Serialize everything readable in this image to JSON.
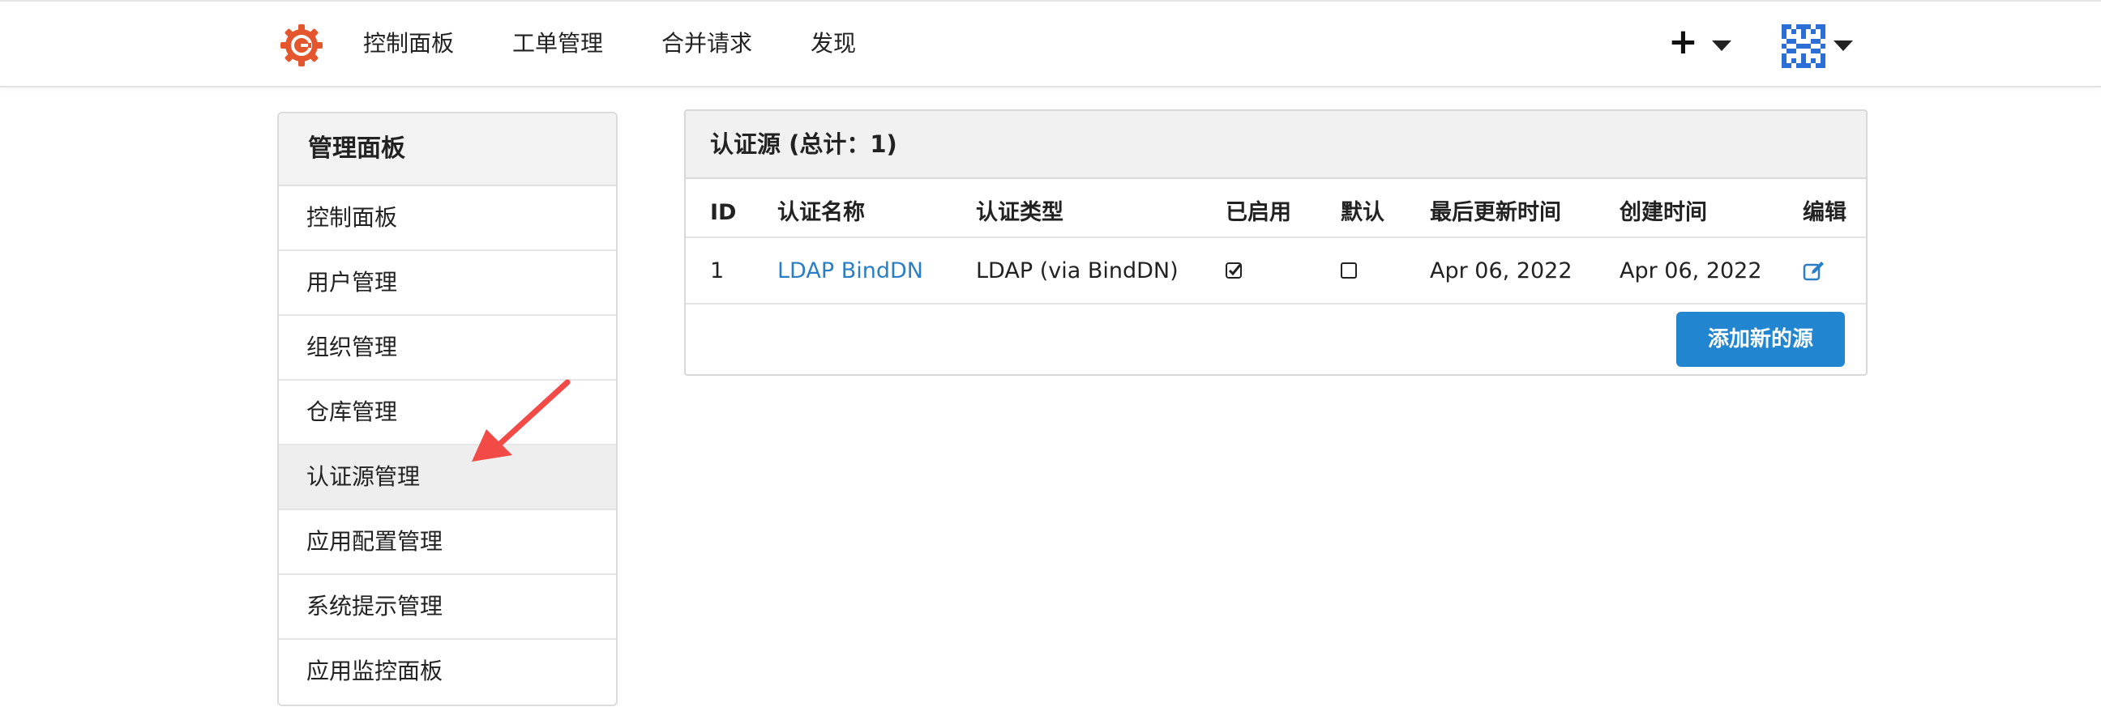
{
  "nav": {
    "items": [
      {
        "label": "控制面板"
      },
      {
        "label": "工单管理"
      },
      {
        "label": "合并请求"
      },
      {
        "label": "发现"
      }
    ],
    "plus_label": "+"
  },
  "sidebar": {
    "title": "管理面板",
    "items": [
      {
        "label": "控制面板"
      },
      {
        "label": "用户管理"
      },
      {
        "label": "组织管理"
      },
      {
        "label": "仓库管理"
      },
      {
        "label": "认证源管理"
      },
      {
        "label": "应用配置管理"
      },
      {
        "label": "系统提示管理"
      },
      {
        "label": "应用监控面板"
      }
    ],
    "active_index": 4
  },
  "panel": {
    "title": "认证源 (总计：1)",
    "columns": [
      "ID",
      "认证名称",
      "认证类型",
      "已启用",
      "默认",
      "最后更新时间",
      "创建时间",
      "编辑"
    ],
    "rows": [
      {
        "id": "1",
        "name": "LDAP BindDN",
        "type": "LDAP (via BindDN)",
        "enabled": true,
        "default": false,
        "updated": "Apr 06, 2022",
        "created": "Apr 06, 2022"
      }
    ],
    "add_button_label": "添加新的源"
  },
  "colors": {
    "accent": "#2185d0",
    "link": "#2a7ec6",
    "logo": "#e4572e",
    "annotation_arrow": "#f24a47"
  }
}
